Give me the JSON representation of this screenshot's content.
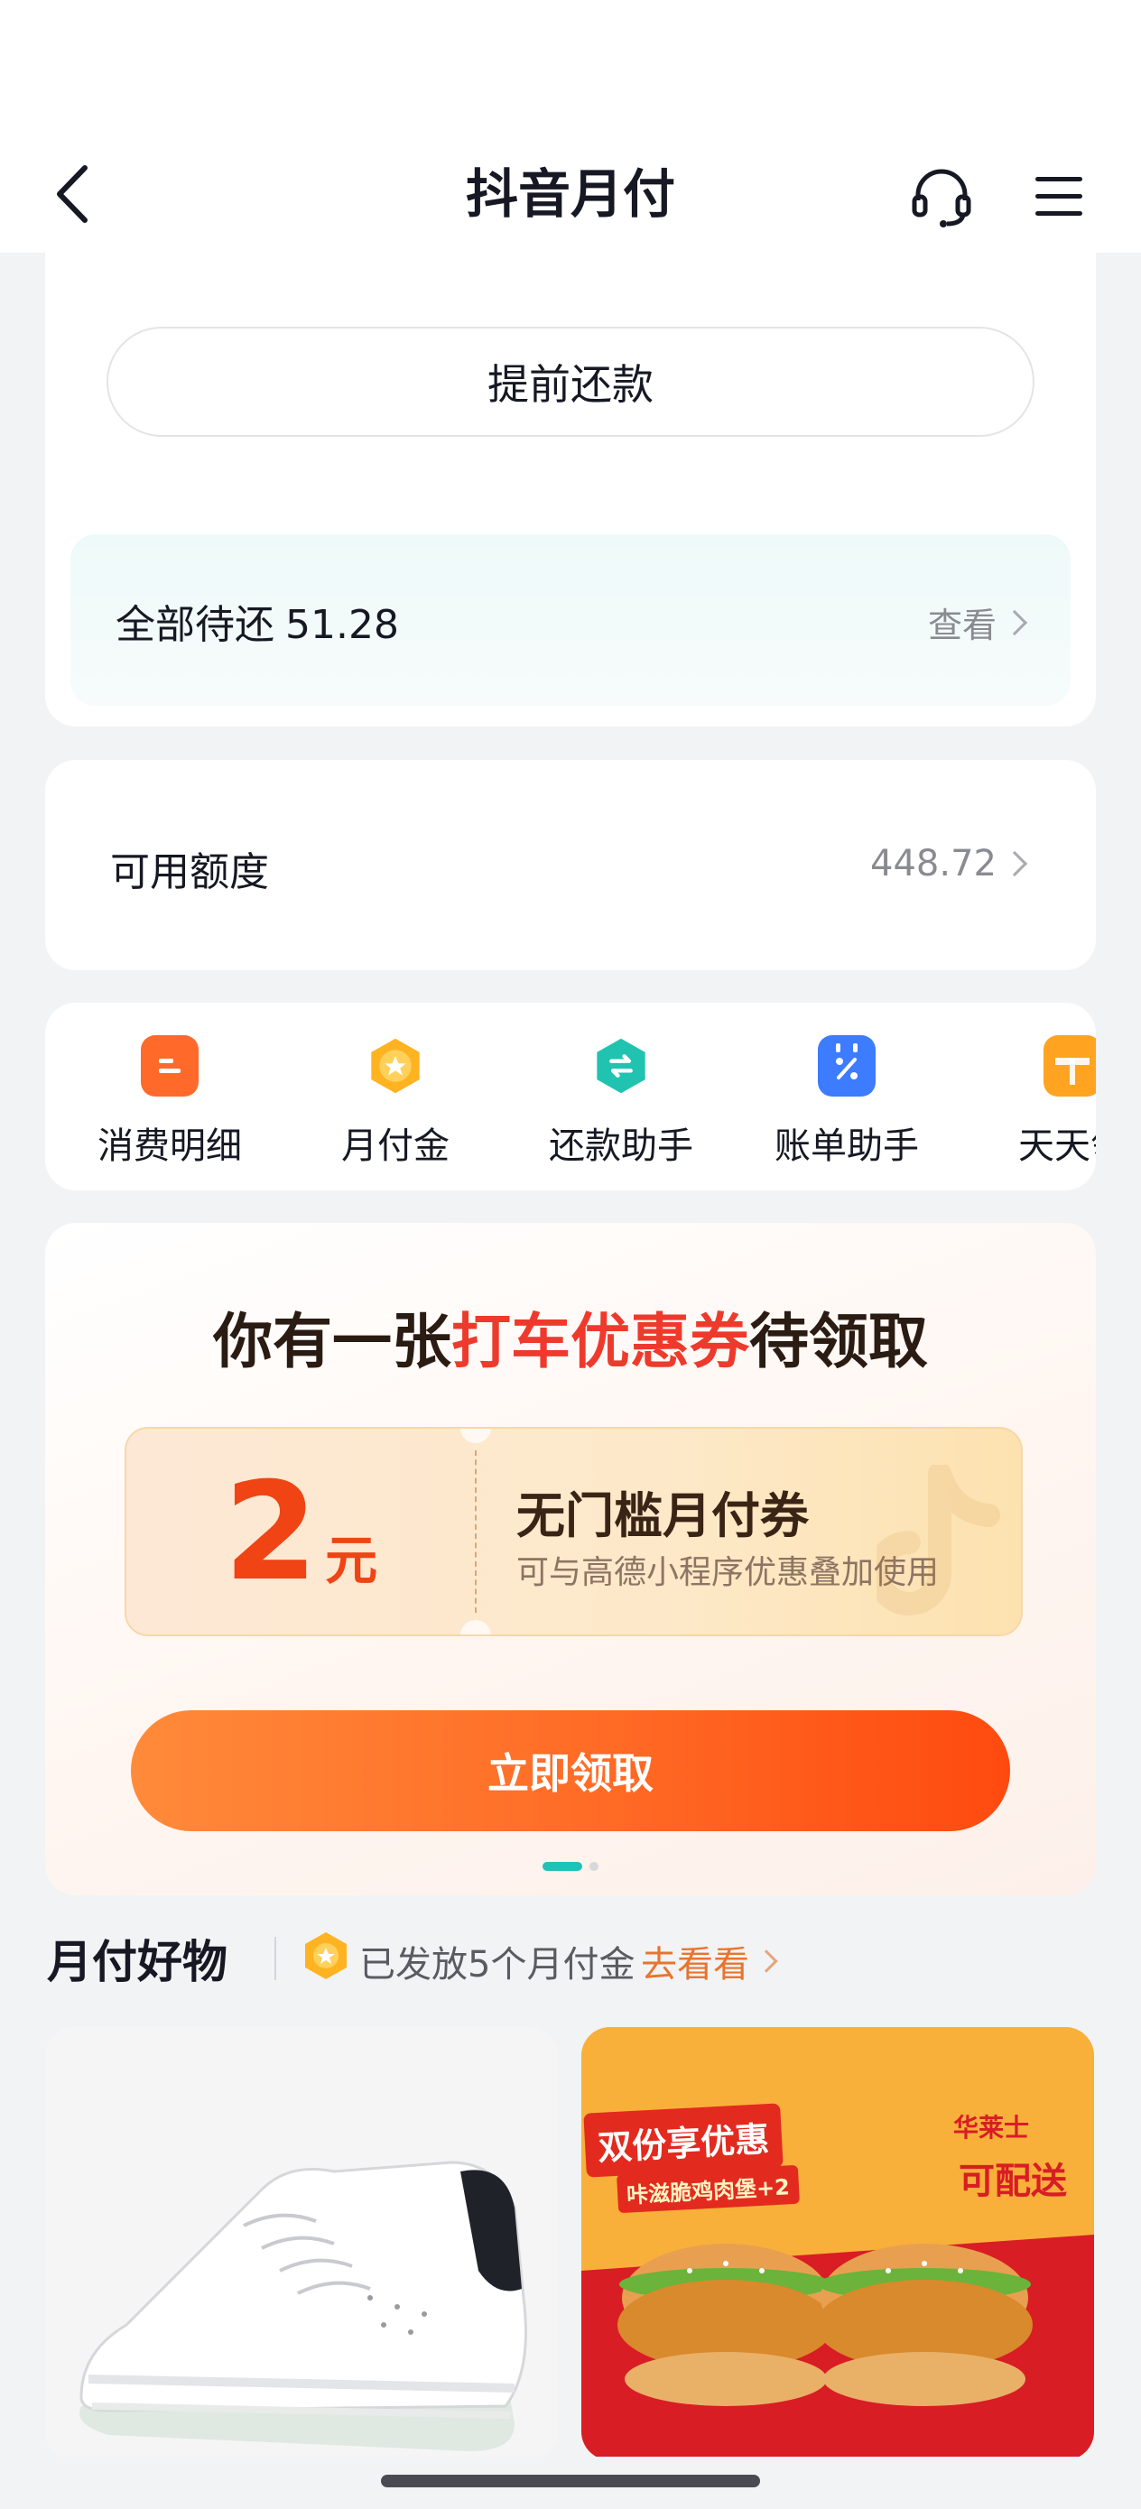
{
  "nav": {
    "title": "抖音月付",
    "back_icon": "chevron-left-icon",
    "service_icon": "headset-icon",
    "menu_icon": "hamburger-menu-icon"
  },
  "repayment": {
    "partial_text": "( ... )",
    "prepay_label": "提前还款",
    "due_label": "全部待还",
    "due_amount": "51.28",
    "view_label": "查看"
  },
  "credit": {
    "label": "可用额度",
    "value": "448.72"
  },
  "services": [
    {
      "label": "消费明细",
      "icon": "document-icon",
      "color": "#ff6a2b"
    },
    {
      "label": "月付金",
      "icon": "star-coin-icon",
      "color": "#ffb321"
    },
    {
      "label": "还款助手",
      "icon": "exchange-icon",
      "color": "#20c3b0"
    },
    {
      "label": "账单助手",
      "icon": "calendar-percent-icon",
      "color": "#3d7bff"
    },
    {
      "label": "天天领",
      "icon": "gift-icon",
      "color": "#ffa320"
    }
  ],
  "promo": {
    "title_prefix": "你有一张",
    "title_highlight": "打车优惠券",
    "title_suffix": "待领取",
    "coupon_amount": "2",
    "coupon_unit": "元",
    "coupon_name": "无门槛月付券",
    "coupon_desc": "可与高德小程序优惠叠加使用",
    "claim_label": "立即领取",
    "accent": "#ee3a2c"
  },
  "goods": {
    "title": "月付好物",
    "badge_text": "已发放5个月付金",
    "link_label": "去看看",
    "products": [
      {
        "name": "white-platform-sneaker-image"
      },
      {
        "banner": "双份享优惠",
        "sub": "咔滋脆鸡肉堡+2",
        "brand": "华莱士",
        "tag": "可配送"
      }
    ]
  }
}
